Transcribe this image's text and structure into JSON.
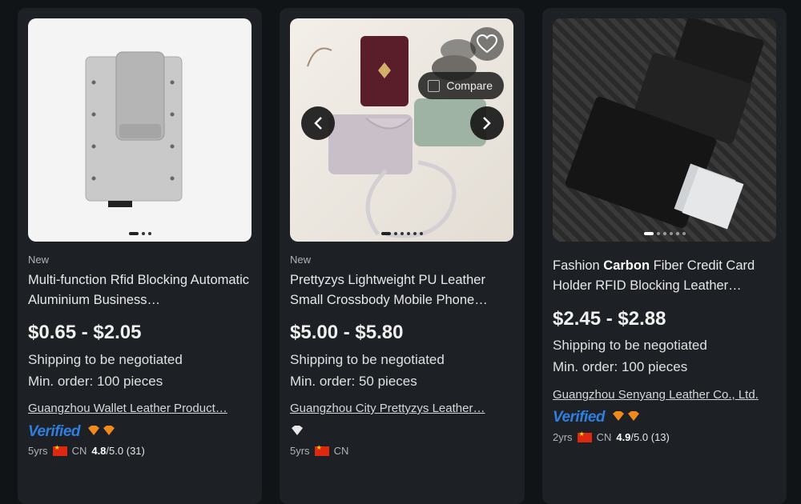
{
  "products": [
    {
      "tag": "New",
      "title": "Multi-function Rfid Blocking Automatic Aluminium Business…",
      "price": "$0.65 - $2.05",
      "shipping": "Shipping to be negotiated",
      "min_order": "Min. order: 100 pieces",
      "supplier": "Guangzhou Wallet Leather Product…",
      "verified": "Verified",
      "years": "5yrs",
      "country": "CN",
      "rating": "4.8",
      "rating_max": "/5.0",
      "reviews": "(31)"
    },
    {
      "tag": "New",
      "title": "Prettyzys Lightweight PU Leather Small Crossbody Mobile Phone…",
      "price": "$5.00 - $5.80",
      "shipping": "Shipping to be negotiated",
      "min_order": "Min. order: 50 pieces",
      "supplier": "Guangzhou City Prettyzys Leather…",
      "years": "5yrs",
      "country": "CN",
      "compare_label": "Compare"
    },
    {
      "title_pre": "Fashion ",
      "title_bold": "Carbon",
      "title_post": " Fiber Credit Card Holder RFID Blocking Leather…",
      "price": "$2.45 - $2.88",
      "shipping": "Shipping to be negotiated",
      "min_order": "Min. order: 100 pieces",
      "supplier": "Guangzhou Senyang Leather Co., Ltd.",
      "verified": "Verified",
      "years": "2yrs",
      "country": "CN",
      "rating": "4.9",
      "rating_max": "/5.0",
      "reviews": "(13)"
    }
  ],
  "colors": {
    "verified_blue": "#2f7fe0",
    "diamond_orange": "#f08a1c",
    "card_bg": "#1d2024"
  }
}
